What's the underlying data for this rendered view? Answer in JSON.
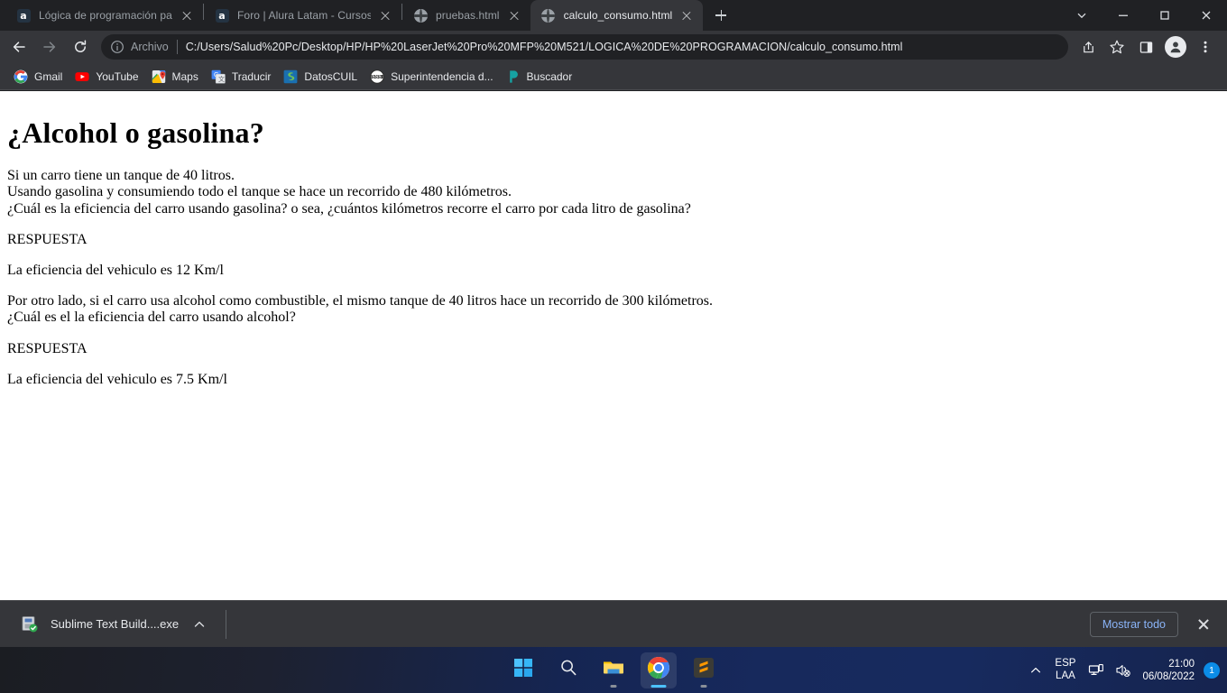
{
  "browser": {
    "tabs": [
      {
        "title": "Lógica de programación parte 1:",
        "favicon": "alura-favicon",
        "active": false
      },
      {
        "title": "Foro | Alura Latam - Cursos onlin",
        "favicon": "alura-favicon",
        "active": false
      },
      {
        "title": "pruebas.html",
        "favicon": "html-file-favicon",
        "active": false
      },
      {
        "title": "calculo_consumo.html",
        "favicon": "html-file-favicon",
        "active": true
      }
    ],
    "window_controls": {
      "tab_search": "chevron-down-icon",
      "minimize": "minimize-icon",
      "maximize": "maximize-icon",
      "close": "close-icon"
    },
    "toolbar": {
      "back": "back-arrow-icon",
      "forward": "forward-arrow-icon",
      "reload": "reload-icon",
      "info_icon": "info-circle-icon",
      "scheme_label": "Archivo",
      "url": "C:/Users/Salud%20Pc/Desktop/HP/HP%20LaserJet%20Pro%20MFP%20M521/LOGICA%20DE%20PROGRAMACION/calculo_consumo.html",
      "share": "share-icon",
      "bookmark": "star-icon",
      "side_panel": "side-panel-icon",
      "profile": "profile-avatar-icon",
      "menu": "three-dot-menu-icon"
    },
    "bookmarks": [
      {
        "label": "Gmail",
        "icon": "gmail-icon"
      },
      {
        "label": "YouTube",
        "icon": "youtube-icon"
      },
      {
        "label": "Maps",
        "icon": "google-maps-icon"
      },
      {
        "label": "Traducir",
        "icon": "google-translate-icon"
      },
      {
        "label": "DatosCUIL",
        "icon": "datoscuil-icon"
      },
      {
        "label": "Superintendencia d...",
        "icon": "sss-icon"
      },
      {
        "label": "Buscador",
        "icon": "buscador-icon"
      }
    ],
    "downloads": {
      "file_name": "Sublime Text Build....exe",
      "file_icon": "installer-file-icon",
      "chevron": "chevron-up-icon",
      "show_all_label": "Mostrar todo",
      "close": "close-icon"
    }
  },
  "page": {
    "heading": "¿Alcohol o gasolina?",
    "paragraphs": [
      {
        "lines": [
          "Si un carro tiene un tanque de 40 litros.",
          "Usando gasolina y consumiendo todo el tanque se hace un recorrido de 480 kilómetros.",
          "¿Cuál es la eficiencia del carro usando gasolina? o sea, ¿cuántos kilómetros recorre el carro por cada litro de gasolina?"
        ]
      },
      {
        "lines": [
          "RESPUESTA"
        ]
      },
      {
        "lines": [
          "La eficiencia del vehiculo es 12 Km/l"
        ]
      },
      {
        "lines": [
          "Por otro lado, si el carro usa alcohol como combustible, el mismo tanque de 40 litros hace un recorrido de 300 kilómetros.",
          "¿Cuál es el la eficiencia del carro usando alcohol?"
        ]
      },
      {
        "lines": [
          "RESPUESTA"
        ]
      },
      {
        "lines": [
          "La eficiencia del vehiculo es 7.5 Km/l"
        ]
      }
    ]
  },
  "taskbar": {
    "apps": [
      {
        "name": "start-button",
        "icon": "windows-logo-icon",
        "active": false,
        "running": false
      },
      {
        "name": "search-button",
        "icon": "search-icon",
        "active": false,
        "running": false
      },
      {
        "name": "file-explorer",
        "icon": "folder-icon",
        "active": false,
        "running": true
      },
      {
        "name": "google-chrome",
        "icon": "chrome-icon",
        "active": true,
        "running": true
      },
      {
        "name": "sublime-text",
        "icon": "sublime-text-icon",
        "active": false,
        "running": true
      }
    ],
    "tray": {
      "overflow": "chevron-up-icon",
      "language_line1": "ESP",
      "language_line2": "LAA",
      "network": "network-icon",
      "volume": "volume-muted-icon",
      "time": "21:00",
      "date": "06/08/2022",
      "notification_count": "1"
    }
  }
}
